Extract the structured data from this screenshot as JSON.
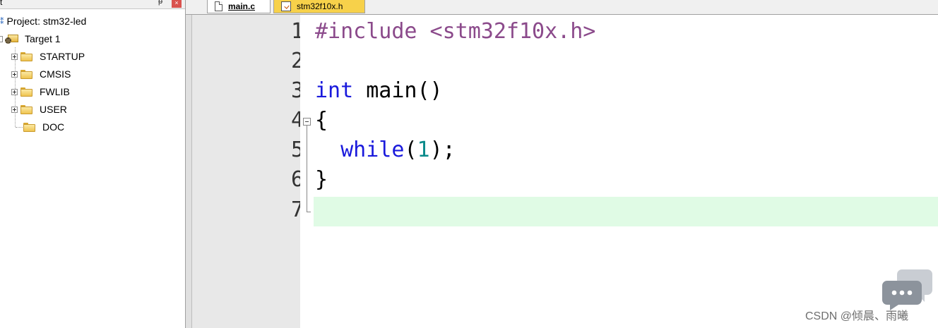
{
  "project_panel": {
    "title": "t",
    "pin_glyph": "ᵽ",
    "close_glyph": "×",
    "project_label": "Project: stm32-led",
    "target_label": "Target 1",
    "groups": [
      {
        "label": "STARTUP",
        "expandable": true
      },
      {
        "label": "CMSIS",
        "expandable": true
      },
      {
        "label": "FWLIB",
        "expandable": true
      },
      {
        "label": "USER",
        "expandable": true
      },
      {
        "label": "DOC",
        "expandable": false
      }
    ]
  },
  "tabs": [
    {
      "label": "main.c",
      "active": true
    },
    {
      "label": "stm32f10x.h",
      "active": false
    }
  ],
  "editor": {
    "line_numbers": [
      "1",
      "2",
      "3",
      "4",
      "5",
      "6",
      "7"
    ],
    "current_line": "7",
    "code": {
      "line1_directive": "#include",
      "line1_header": " <stm32f10x.h>",
      "line3_type": "int",
      "line3_rest": " main()",
      "line4": "{",
      "line5_indent": "  ",
      "line5_keyword": "while",
      "line5_open": "(",
      "line5_number": "1",
      "line5_close": ");",
      "line6": "}"
    }
  },
  "watermark": "CSDN @倾晨、雨曦",
  "colors": {
    "preprocessor": "#8b4a8b",
    "keyword": "#1a1adc",
    "number": "#0a8a8a",
    "current_line_bg": "#e0fbe5",
    "active_tab_bg": "#f7d14a"
  }
}
